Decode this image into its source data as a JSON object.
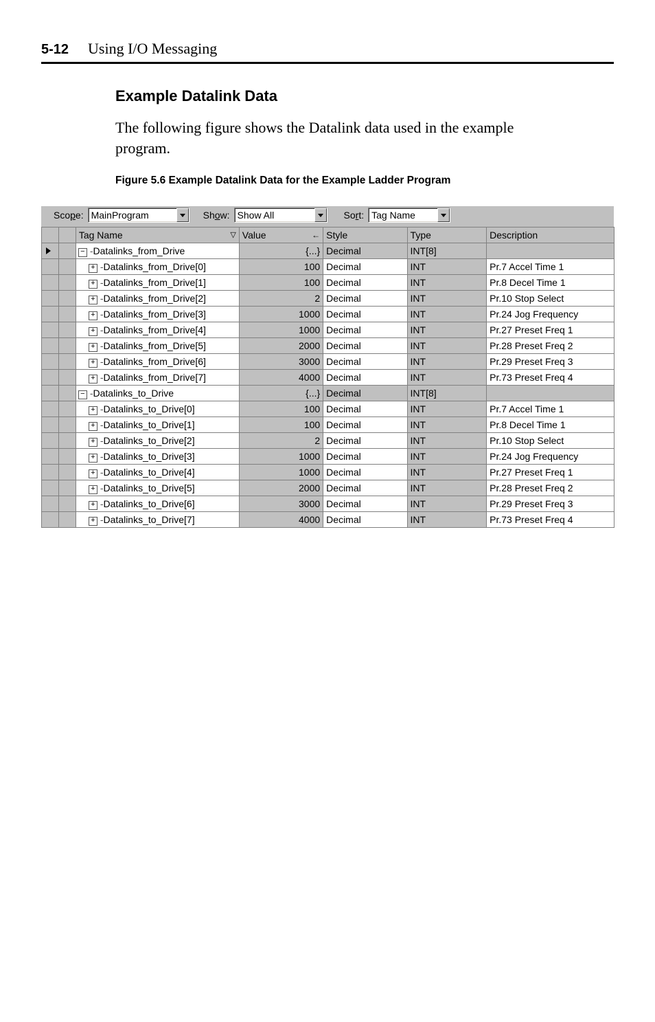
{
  "header": {
    "page_num": "5-12",
    "chapter": "Using I/O Messaging"
  },
  "section_title": "Example Datalink Data",
  "intro_text": "The following figure shows the Datalink data used in the example program.",
  "figure_caption": "Figure 5.6   Example Datalink Data for the Example Ladder Program",
  "toolbar": {
    "scope_label_pre": "Sco",
    "scope_label_u": "p",
    "scope_label_post": "e:",
    "scope_value": "MainProgram",
    "show_label_pre": "Sh",
    "show_label_u": "o",
    "show_label_post": "w:",
    "show_value": "Show All",
    "sort_label_pre": "So",
    "sort_label_u": "r",
    "sort_label_post": "t:",
    "sort_value": "Tag Name"
  },
  "columns": {
    "tag_name": "Tag Name",
    "value": "Value",
    "style": "Style",
    "type": "Type",
    "description": "Description"
  },
  "rows": [
    {
      "kind": "parent",
      "selected": true,
      "indent": 0,
      "expander": "−",
      "name": "Datalinks_from_Drive",
      "value": "{...}",
      "style": "Decimal",
      "type": "INT[8]",
      "description": ""
    },
    {
      "kind": "child",
      "selected": false,
      "indent": 1,
      "expander": "+",
      "name": "Datalinks_from_Drive[0]",
      "value": "100",
      "style": "Decimal",
      "type": "INT",
      "description": "Pr.7 Accel Time 1"
    },
    {
      "kind": "child",
      "selected": false,
      "indent": 1,
      "expander": "+",
      "name": "Datalinks_from_Drive[1]",
      "value": "100",
      "style": "Decimal",
      "type": "INT",
      "description": "Pr.8 Decel Time 1"
    },
    {
      "kind": "child",
      "selected": false,
      "indent": 1,
      "expander": "+",
      "name": "Datalinks_from_Drive[2]",
      "value": "2",
      "style": "Decimal",
      "type": "INT",
      "description": "Pr.10 Stop Select"
    },
    {
      "kind": "child",
      "selected": false,
      "indent": 1,
      "expander": "+",
      "name": "Datalinks_from_Drive[3]",
      "value": "1000",
      "style": "Decimal",
      "type": "INT",
      "description": "Pr.24 Jog Frequency"
    },
    {
      "kind": "child",
      "selected": false,
      "indent": 1,
      "expander": "+",
      "name": "Datalinks_from_Drive[4]",
      "value": "1000",
      "style": "Decimal",
      "type": "INT",
      "description": "Pr.27 Preset Freq 1"
    },
    {
      "kind": "child",
      "selected": false,
      "indent": 1,
      "expander": "+",
      "name": "Datalinks_from_Drive[5]",
      "value": "2000",
      "style": "Decimal",
      "type": "INT",
      "description": "Pr.28 Preset Freq 2"
    },
    {
      "kind": "child",
      "selected": false,
      "indent": 1,
      "expander": "+",
      "name": "Datalinks_from_Drive[6]",
      "value": "3000",
      "style": "Decimal",
      "type": "INT",
      "description": "Pr.29 Preset Freq 3"
    },
    {
      "kind": "child",
      "selected": false,
      "indent": 1,
      "expander": "+",
      "name": "Datalinks_from_Drive[7]",
      "value": "4000",
      "style": "Decimal",
      "type": "INT",
      "description": "Pr.73 Preset Freq 4"
    },
    {
      "kind": "parent",
      "selected": false,
      "indent": 0,
      "expander": "−",
      "name": "Datalinks_to_Drive",
      "value": "{...}",
      "style": "Decimal",
      "type": "INT[8]",
      "description": ""
    },
    {
      "kind": "child",
      "selected": false,
      "indent": 1,
      "expander": "+",
      "name": "Datalinks_to_Drive[0]",
      "value": "100",
      "style": "Decimal",
      "type": "INT",
      "description": "Pr.7 Accel Time 1"
    },
    {
      "kind": "child",
      "selected": false,
      "indent": 1,
      "expander": "+",
      "name": "Datalinks_to_Drive[1]",
      "value": "100",
      "style": "Decimal",
      "type": "INT",
      "description": "Pr.8 Decel Time 1"
    },
    {
      "kind": "child",
      "selected": false,
      "indent": 1,
      "expander": "+",
      "name": "Datalinks_to_Drive[2]",
      "value": "2",
      "style": "Decimal",
      "type": "INT",
      "description": "Pr.10 Stop Select"
    },
    {
      "kind": "child",
      "selected": false,
      "indent": 1,
      "expander": "+",
      "name": "Datalinks_to_Drive[3]",
      "value": "1000",
      "style": "Decimal",
      "type": "INT",
      "description": "Pr.24 Jog Frequency"
    },
    {
      "kind": "child",
      "selected": false,
      "indent": 1,
      "expander": "+",
      "name": "Datalinks_to_Drive[4]",
      "value": "1000",
      "style": "Decimal",
      "type": "INT",
      "description": "Pr.27 Preset Freq 1"
    },
    {
      "kind": "child",
      "selected": false,
      "indent": 1,
      "expander": "+",
      "name": "Datalinks_to_Drive[5]",
      "value": "2000",
      "style": "Decimal",
      "type": "INT",
      "description": "Pr.28 Preset Freq 2"
    },
    {
      "kind": "child",
      "selected": false,
      "indent": 1,
      "expander": "+",
      "name": "Datalinks_to_Drive[6]",
      "value": "3000",
      "style": "Decimal",
      "type": "INT",
      "description": "Pr.29 Preset Freq 3"
    },
    {
      "kind": "child",
      "selected": false,
      "indent": 1,
      "expander": "+",
      "name": "Datalinks_to_Drive[7]",
      "value": "4000",
      "style": "Decimal",
      "type": "INT",
      "description": "Pr.73 Preset Freq 4"
    }
  ]
}
